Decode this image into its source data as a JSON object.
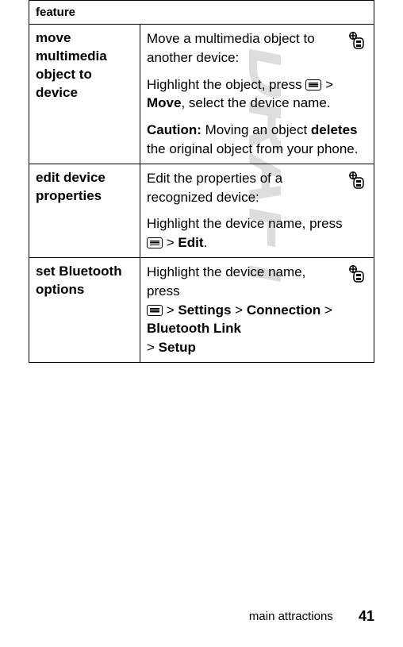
{
  "header": {
    "feature_label": "feature"
  },
  "rows": {
    "r1": {
      "title": "move multimedia object to device",
      "p1a": "Move a multimedia object to another device:",
      "p2a": "Highlight the object, press ",
      "p2b": " > ",
      "p2c": "Move",
      "p2d": ", select the device name.",
      "p3a": "Caution:",
      "p3b": " Moving an object ",
      "p3c": "deletes",
      "p3d": " the original object from your phone."
    },
    "r2": {
      "title": "edit device properties",
      "p1a": "Edit the properties of a recognized device:",
      "p2a": "Highlight the device name, press ",
      "p2b": " > ",
      "p2c": "Edit",
      "p2d": "."
    },
    "r3": {
      "title": "set Bluetooth options",
      "p1a": "Highlight the device name, press ",
      "p1b": " > ",
      "p1c": "Settings",
      "p1d": " > ",
      "p1e": "Connection",
      "p1f": " > ",
      "p1g": "Bluetooth Link",
      "p1h": " > ",
      "p1i": "Setup"
    }
  },
  "watermark": {
    "text": "DRAFT"
  },
  "footer": {
    "section": "main attractions",
    "page": "41"
  }
}
